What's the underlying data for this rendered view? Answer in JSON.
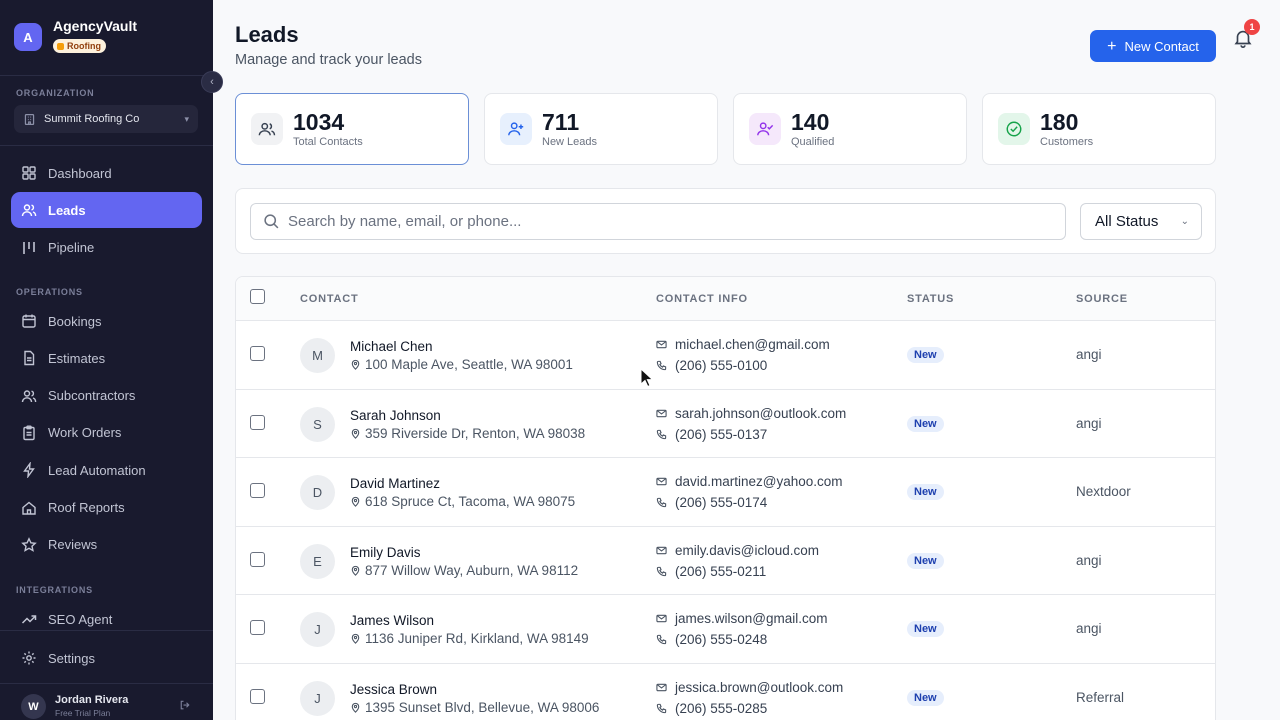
{
  "brand": {
    "initial": "A",
    "name": "AgencyVault",
    "badge": "Roofing"
  },
  "sidebar": {
    "org_label": "ORGANIZATION",
    "org_name": "Summit Roofing Co",
    "nav_main": [
      {
        "label": "Dashboard",
        "icon": "dashboard-icon"
      },
      {
        "label": "Leads",
        "icon": "users-icon",
        "active": true
      },
      {
        "label": "Pipeline",
        "icon": "pipeline-icon"
      }
    ],
    "operations_label": "OPERATIONS",
    "nav_operations": [
      {
        "label": "Bookings",
        "icon": "calendar-icon"
      },
      {
        "label": "Estimates",
        "icon": "document-icon"
      },
      {
        "label": "Subcontractors",
        "icon": "users-icon"
      },
      {
        "label": "Work Orders",
        "icon": "clipboard-icon"
      },
      {
        "label": "Lead Automation",
        "icon": "lightning-icon"
      },
      {
        "label": "Roof Reports",
        "icon": "home-icon"
      },
      {
        "label": "Reviews",
        "icon": "star-icon"
      }
    ],
    "integrations_label": "INTEGRATIONS",
    "nav_integrations": [
      {
        "label": "SEO Agent",
        "icon": "trending-icon"
      }
    ],
    "settings_label": "Settings",
    "user": {
      "initial": "W",
      "name": "Jordan Rivera",
      "plan": "Free Trial Plan"
    }
  },
  "header": {
    "title": "Leads",
    "subtitle": "Manage and track your leads",
    "new_contact_label": "New Contact",
    "notification_count": "1"
  },
  "stats": [
    {
      "value": "1034",
      "label": "Total Contacts",
      "icon": "users-icon",
      "bg": "#f1f2f4",
      "fg": "#374151",
      "selected": true
    },
    {
      "value": "711",
      "label": "New Leads",
      "icon": "user-plus-icon",
      "bg": "#e7f0fd",
      "fg": "#2563eb"
    },
    {
      "value": "140",
      "label": "Qualified",
      "icon": "user-check-icon",
      "bg": "#f5e8fb",
      "fg": "#9333ea"
    },
    {
      "value": "180",
      "label": "Customers",
      "icon": "check-circle-icon",
      "bg": "#e3f6ea",
      "fg": "#16a34a"
    }
  ],
  "search": {
    "placeholder": "Search by name, email, or phone...",
    "status_filter": "All Status"
  },
  "table": {
    "columns": [
      "CONTACT",
      "CONTACT INFO",
      "STATUS",
      "SOURCE"
    ],
    "rows": [
      {
        "initial": "M",
        "name": "Michael Chen",
        "address": "100 Maple Ave, Seattle, WA 98001",
        "email": "michael.chen@gmail.com",
        "phone": "(206) 555-0100",
        "status": "New",
        "source": "angi"
      },
      {
        "initial": "S",
        "name": "Sarah Johnson",
        "address": "359 Riverside Dr, Renton, WA 98038",
        "email": "sarah.johnson@outlook.com",
        "phone": "(206) 555-0137",
        "status": "New",
        "source": "angi"
      },
      {
        "initial": "D",
        "name": "David Martinez",
        "address": "618 Spruce Ct, Tacoma, WA 98075",
        "email": "david.martinez@yahoo.com",
        "phone": "(206) 555-0174",
        "status": "New",
        "source": "Nextdoor"
      },
      {
        "initial": "E",
        "name": "Emily Davis",
        "address": "877 Willow Way, Auburn, WA 98112",
        "email": "emily.davis@icloud.com",
        "phone": "(206) 555-0211",
        "status": "New",
        "source": "angi"
      },
      {
        "initial": "J",
        "name": "James Wilson",
        "address": "1136 Juniper Rd, Kirkland, WA 98149",
        "email": "james.wilson@gmail.com",
        "phone": "(206) 555-0248",
        "status": "New",
        "source": "angi"
      },
      {
        "initial": "J",
        "name": "Jessica Brown",
        "address": "1395 Sunset Blvd, Bellevue, WA 98006",
        "email": "jessica.brown@outlook.com",
        "phone": "(206) 555-0285",
        "status": "New",
        "source": "Referral"
      }
    ]
  }
}
